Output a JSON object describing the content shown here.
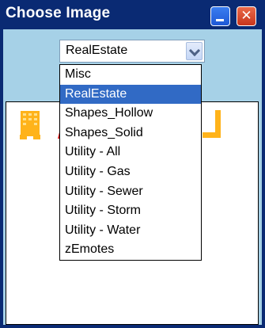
{
  "window": {
    "title": "Choose Image"
  },
  "select": {
    "value": "RealEstate"
  },
  "dropdown": {
    "items": [
      "Misc",
      "RealEstate",
      "Shapes_Hollow",
      "Shapes_Solid",
      "Utility - All",
      "Utility - Gas",
      "Utility - Sewer",
      "Utility - Storm",
      "Utility - Water",
      "zEmotes"
    ],
    "selected_index": 1
  },
  "colors": {
    "titlebar": "#0a2a73",
    "client_background": "#a6d1e7",
    "selection_highlight": "#316ac5",
    "icon_orange": "#ffb31a",
    "icon_red": "#e01010"
  },
  "icons": {
    "minimize": "minimize-icon",
    "close": "close-icon",
    "dropdown_arrow": "chevron-down-icon",
    "preview_images": [
      "building-icon",
      "flag-icon",
      "corner-icon"
    ]
  }
}
